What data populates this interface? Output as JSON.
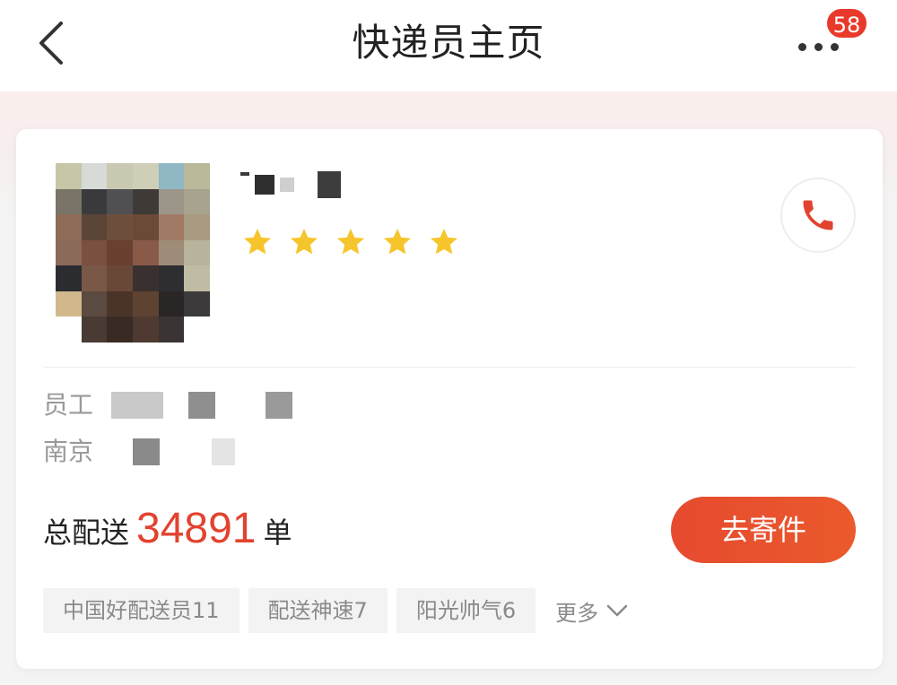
{
  "header": {
    "title": "快递员主页",
    "back_icon": "chevron-left-icon",
    "more_icon": "more-dots-icon",
    "notification_count": "58"
  },
  "courier": {
    "rating_stars": 5,
    "rating_max": 5,
    "employee_label_prefix": "员工",
    "branch_prefix": "南京",
    "total_label": "总配送",
    "total_count": "34891",
    "total_unit": "单",
    "send_button": "去寄件"
  },
  "tags": {
    "items": [
      "中国好配送员11",
      "配送神速7",
      "阳光帅气6"
    ],
    "more_label": "更多"
  },
  "colors": {
    "accent": "#e2432f",
    "star": "#f6c52b",
    "badge": "#e8392b"
  }
}
